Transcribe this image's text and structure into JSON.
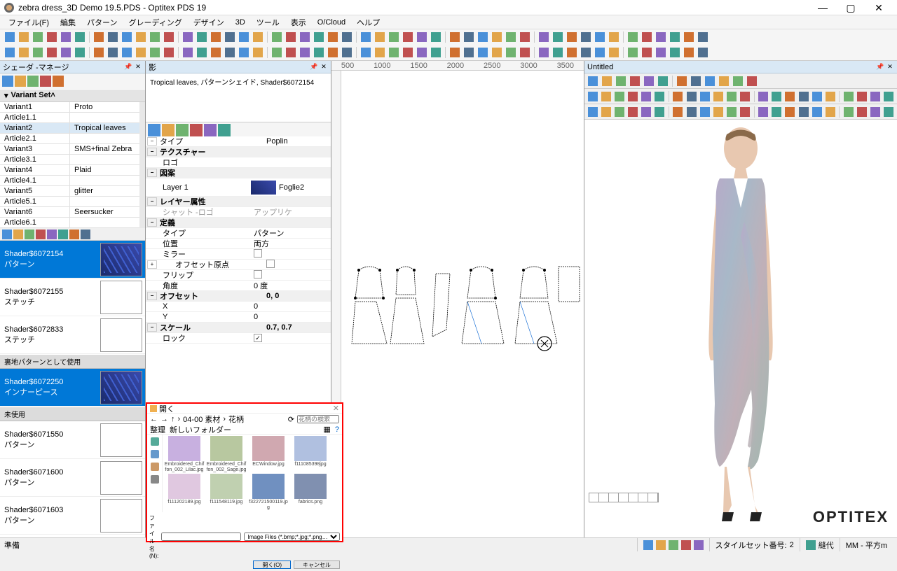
{
  "window": {
    "title": "zebra dress_3D Demo 19.5.PDS - Optitex PDS 19",
    "min": "—",
    "max": "▢",
    "close": "✕"
  },
  "menu": [
    "ファイル(F)",
    "編集",
    "パターン",
    "グレーディング",
    "デザイン",
    "3D",
    "ツール",
    "表示",
    "O/Cloud",
    "ヘルプ"
  ],
  "left_panel": {
    "title": "シェーダ  -マネージ",
    "variant_set": "Variant Set",
    "rows": [
      {
        "a": "Variant1",
        "b": "Proto"
      },
      {
        "a": "Article1.1",
        "b": ""
      },
      {
        "a": "Variant2",
        "b": "Tropical leaves",
        "sel": true
      },
      {
        "a": "Article2.1",
        "b": ""
      },
      {
        "a": "Variant3",
        "b": "SMS+final Zebra"
      },
      {
        "a": "Article3.1",
        "b": ""
      },
      {
        "a": "Variant4",
        "b": "Plaid"
      },
      {
        "a": "Article4.1",
        "b": ""
      },
      {
        "a": "Variant5",
        "b": "glitter"
      },
      {
        "a": "Article5.1",
        "b": ""
      },
      {
        "a": "Variant6",
        "b": "Seersucker"
      },
      {
        "a": "Article6.1",
        "b": ""
      }
    ],
    "group1": "裏地パターンとして使用",
    "group2": "未使用",
    "shaders": [
      {
        "name": "Shader$6072154",
        "sub": "パターン",
        "sel": true,
        "th": "tropical"
      },
      {
        "name": "Shader$6072155",
        "sub": "ステッチ"
      },
      {
        "name": "Shader$6072833",
        "sub": "ステッチ"
      }
    ],
    "shaders_liner": [
      {
        "name": "Shader$6072250",
        "sub": "インナーピース",
        "sel": true,
        "th": "tropical"
      }
    ],
    "shaders_unused": [
      {
        "name": "Shader$6071550",
        "sub": "パターン"
      },
      {
        "name": "Shader$6071600",
        "sub": "パターン"
      },
      {
        "name": "Shader$6071603",
        "sub": "パターン"
      }
    ]
  },
  "mid_panel": {
    "title": "影",
    "desc": "Tropical leaves, パターンシェイド, Shader$6072154",
    "type_lbl": "タイプ",
    "type_val": "Poplin",
    "texture": "テクスチャー",
    "logo": "ロゴ",
    "zi": "図案",
    "layer_lbl": "Layer   1",
    "layer_val": "Foglie2",
    "layer_attr": "レイヤー属性",
    "shut_logo": "シャット  -ロゴ",
    "shut_logo_val": "アップリケ",
    "def": "定義",
    "sub_type": "タイプ",
    "sub_type_val": "パターン",
    "pos": "位置",
    "pos_val": "両方",
    "mirror": "ミラー",
    "offset_origin": "オフセット原点",
    "flip": "フリップ",
    "angle": "角度",
    "angle_val": "0 度",
    "offset": "オフセット",
    "offset_val": "0, 0",
    "X": "X",
    "X_val": "0",
    "Y": "Y",
    "Y_val": "0",
    "scale": "スケール",
    "scale_val": "0.7, 0.7",
    "lock": "ロック"
  },
  "right_panel": {
    "title": "Untitled",
    "logo": "OPTITEX"
  },
  "canvas": {
    "ruler": [
      "500",
      "1000",
      "1500",
      "2000",
      "2500",
      "3000",
      "3500"
    ]
  },
  "file_dialog": {
    "title": "開く",
    "path_parts": [
      "04-00 素材",
      "花柄"
    ],
    "search_ph": "花柄の検索",
    "org": "整理",
    "new_folder": "新しいフォルダー",
    "files": [
      {
        "n": "Embroidered_Chiffon_002_Lilac.jpg",
        "c": "#c8b0e0"
      },
      {
        "n": "Embroidered_Chiffon_002_Sage.jpg",
        "c": "#b8c8a0"
      },
      {
        "n": "ECWindow.jpg",
        "c": "#d0a8b0"
      },
      {
        "n": "f111085398jpg",
        "c": "#b0c0e0"
      },
      {
        "n": "f111202189.jpg",
        "c": "#e0c8e0"
      },
      {
        "n": "f111548119.jpg",
        "c": "#c0d0b0"
      },
      {
        "n": "f322721500119.jpg",
        "c": "#7090c0"
      },
      {
        "n": "fabrics.png",
        "c": "#8090b0"
      }
    ],
    "file_name_lbl": "ファイル名(N):",
    "filter": "Image Files (*.bmp;*.jpg;*.png…",
    "open": "開く(O)",
    "cancel": "キャンセル"
  },
  "status": {
    "ready": "準備",
    "styleset_lbl": "スタイルセット番号:",
    "styleset_val": "2",
    "seam": "縫代",
    "units": "MM - 平方m"
  }
}
